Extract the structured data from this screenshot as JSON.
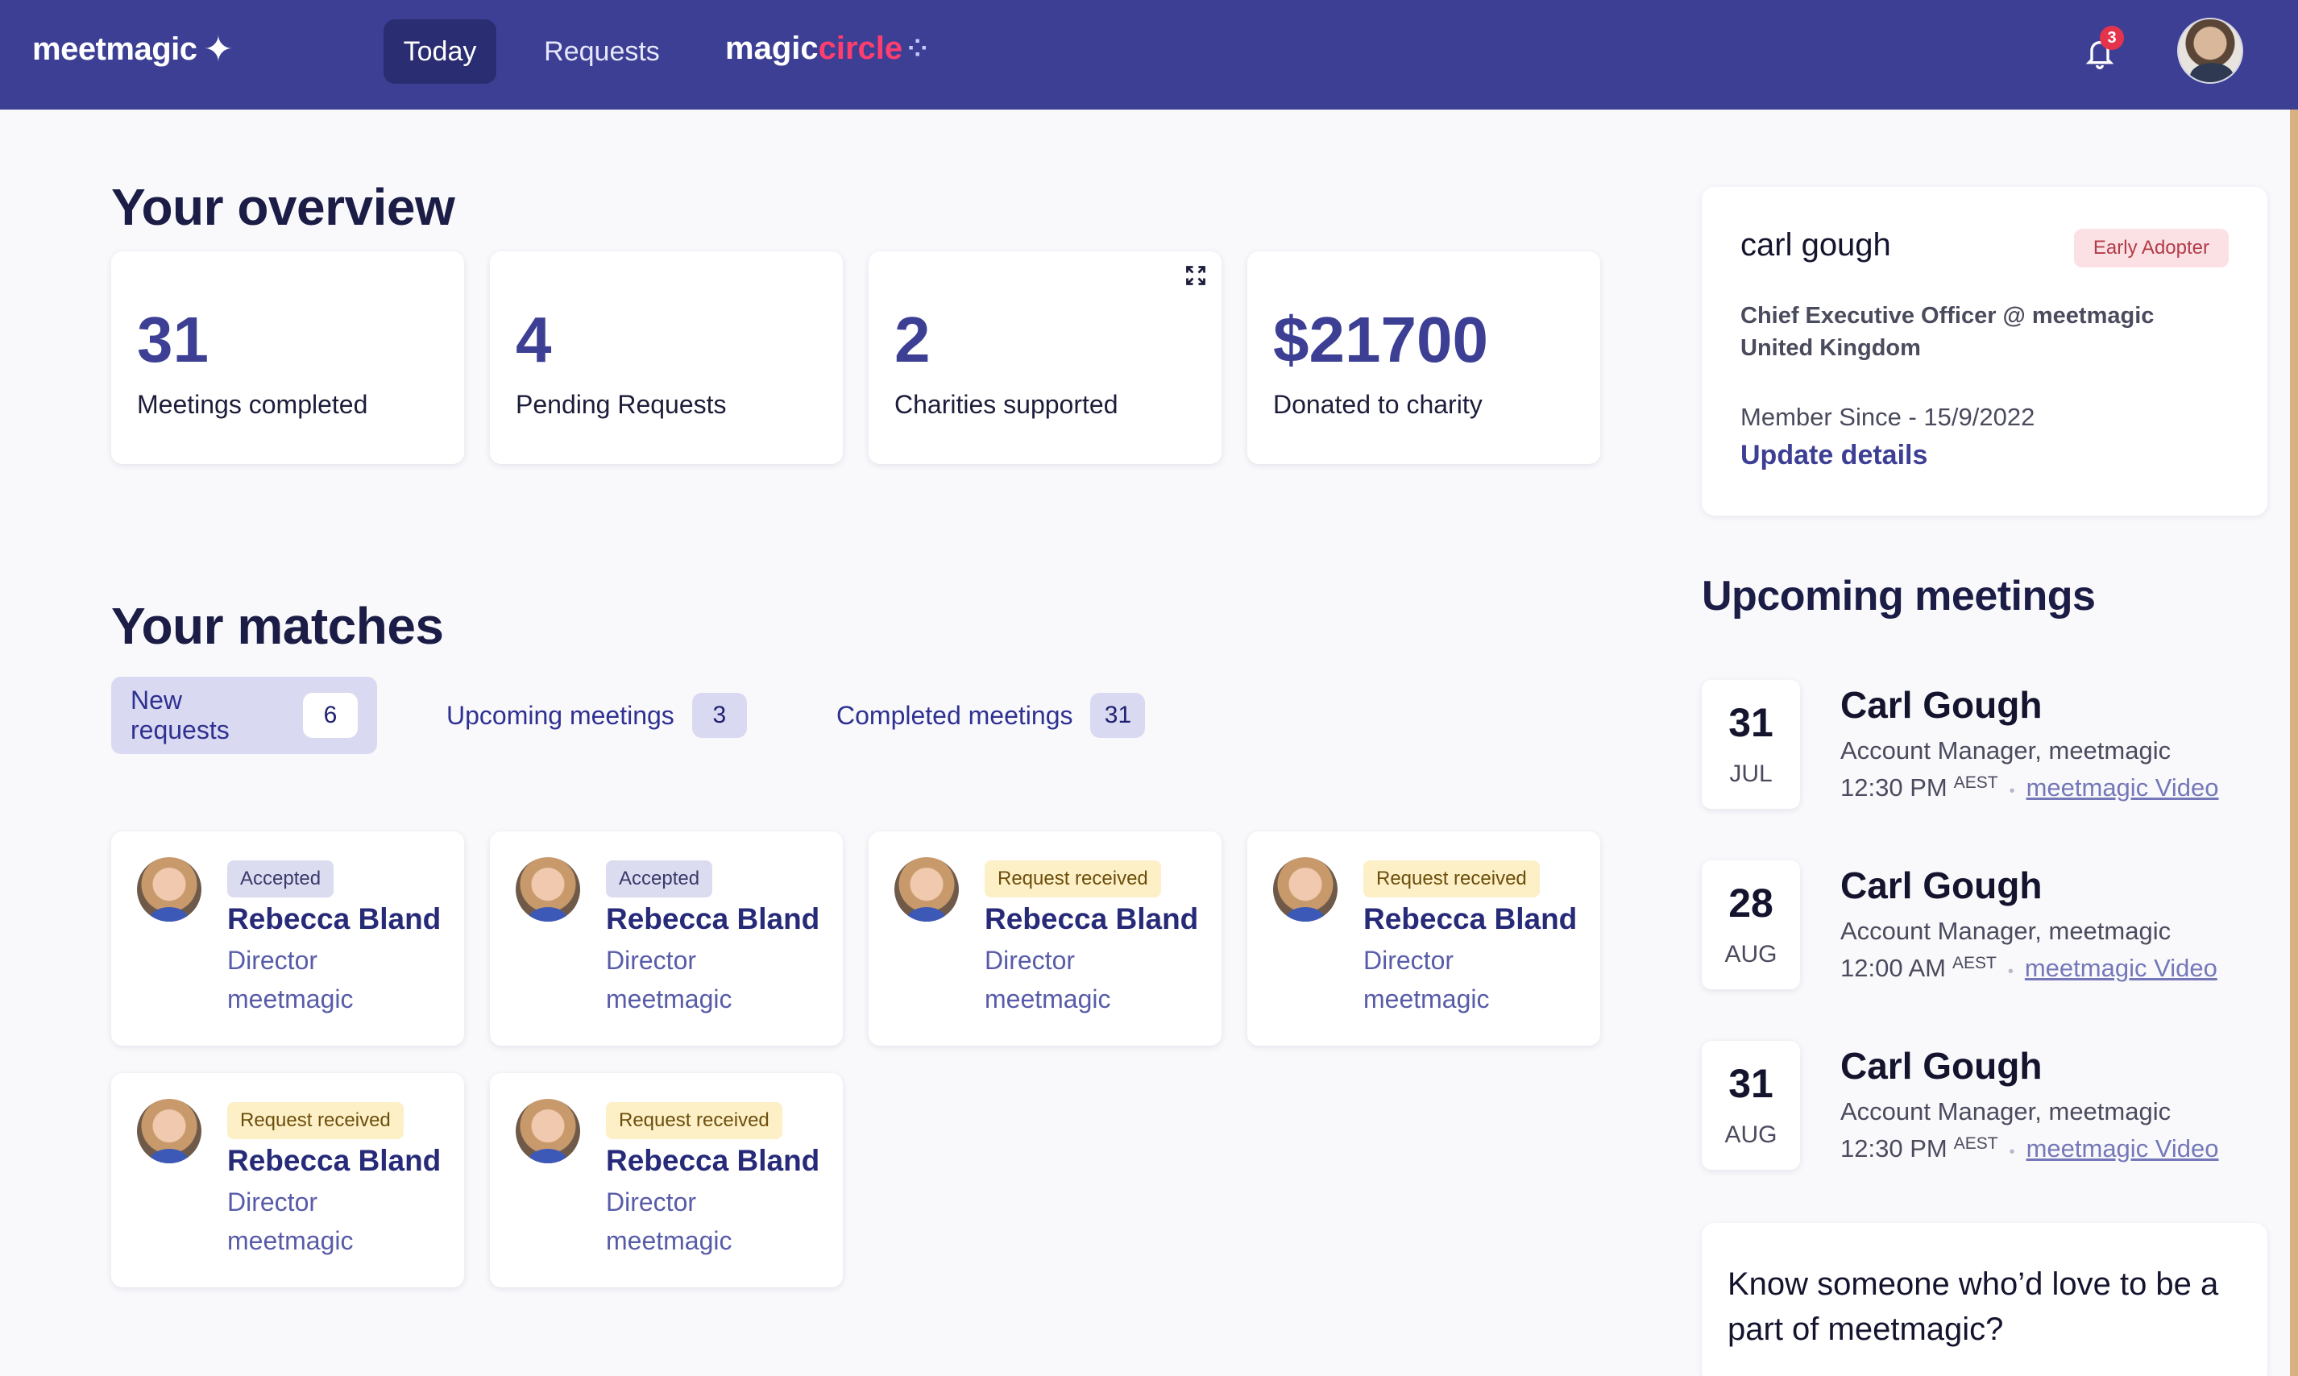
{
  "nav": {
    "logo": "meetmagic",
    "tabs": [
      {
        "label": "Today",
        "active": true
      },
      {
        "label": "Requests",
        "active": false
      }
    ],
    "circle_logo_a": "magic",
    "circle_logo_b": "circle",
    "notification_count": "3"
  },
  "overview": {
    "title": "Your overview",
    "stats": [
      {
        "value": "31",
        "label": "Meetings completed"
      },
      {
        "value": "4",
        "label": "Pending Requests"
      },
      {
        "value": "2",
        "label": "Charities supported"
      },
      {
        "value": "$21700",
        "label": "Donated to charity"
      }
    ]
  },
  "profile": {
    "name": "carl gough",
    "tag": "Early Adopter",
    "role_line1": "Chief Executive Officer @ meetmagic",
    "role_line2": "United Kingdom",
    "member_since": "Member Since - 15/9/2022",
    "update_label": "Update details"
  },
  "matches": {
    "title": "Your matches",
    "tabs": [
      {
        "label": "New requests",
        "count": "6",
        "active": true
      },
      {
        "label": "Upcoming meetings",
        "count": "3",
        "active": false
      },
      {
        "label": "Completed meetings",
        "count": "31",
        "active": false
      }
    ],
    "cards": [
      {
        "status": "Accepted",
        "name": "Rebecca Bland",
        "role": "Director",
        "company": "meetmagic"
      },
      {
        "status": "Accepted",
        "name": "Rebecca Bland",
        "role": "Director",
        "company": "meetmagic"
      },
      {
        "status": "Request received",
        "name": "Rebecca Bland",
        "role": "Director",
        "company": "meetmagic"
      },
      {
        "status": "Request received",
        "name": "Rebecca Bland",
        "role": "Director",
        "company": "meetmagic"
      },
      {
        "status": "Request received",
        "name": "Rebecca Bland",
        "role": "Director",
        "company": "meetmagic"
      },
      {
        "status": "Request received",
        "name": "Rebecca Bland",
        "role": "Director",
        "company": "meetmagic"
      }
    ]
  },
  "upcoming": {
    "title": "Upcoming meetings",
    "items": [
      {
        "day": "31",
        "month": "JUL",
        "name": "Carl Gough",
        "position": "Account Manager, meetmagic",
        "time": "12:30 PM",
        "tz": "AEST",
        "link": "meetmagic Video"
      },
      {
        "day": "28",
        "month": "AUG",
        "name": "Carl Gough",
        "position": "Account Manager, meetmagic",
        "time": "12:00 AM",
        "tz": "AEST",
        "link": "meetmagic Video"
      },
      {
        "day": "31",
        "month": "AUG",
        "name": "Carl Gough",
        "position": "Account Manager, meetmagic",
        "time": "12:30 PM",
        "tz": "AEST",
        "link": "meetmagic Video"
      }
    ]
  },
  "invite": {
    "text": "Know someone who’d love to be a part of meetmagic?"
  },
  "colors": {
    "nav_bg": "#3d3f94",
    "accent": "#3d3f94",
    "circle_pink": "#ff3d6e",
    "badge_red": "#e5334b"
  }
}
